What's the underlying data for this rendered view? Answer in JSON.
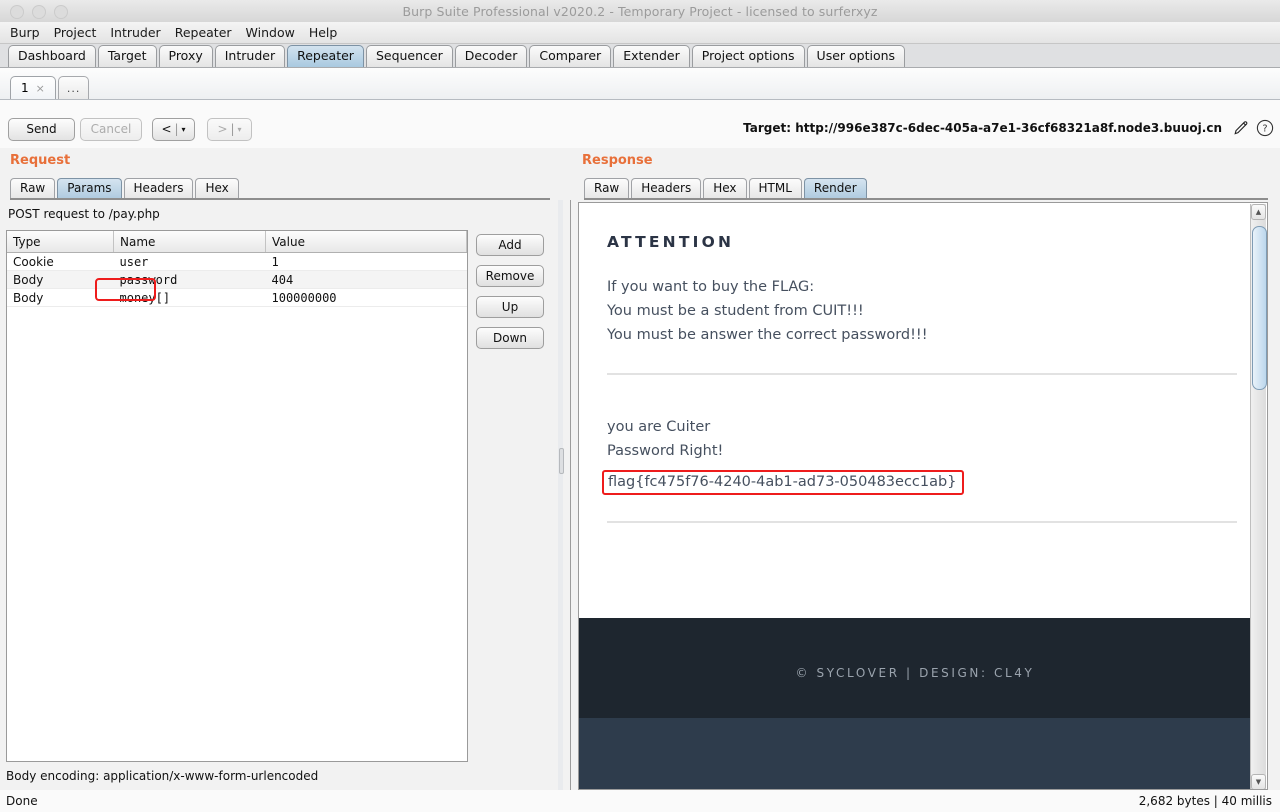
{
  "window": {
    "title": "Burp Suite Professional v2020.2 - Temporary Project - licensed to surferxyz"
  },
  "menubar": {
    "items": [
      "Burp",
      "Project",
      "Intruder",
      "Repeater",
      "Window",
      "Help"
    ]
  },
  "main_tabs": {
    "selected": "Repeater",
    "items": [
      "Dashboard",
      "Target",
      "Proxy",
      "Intruder",
      "Repeater",
      "Sequencer",
      "Decoder",
      "Comparer",
      "Extender",
      "Project options",
      "User options"
    ]
  },
  "repeater_tabs": {
    "items": [
      {
        "label": "1",
        "close": "×",
        "selected": true
      },
      {
        "label": "...",
        "selected": false
      }
    ]
  },
  "actions": {
    "send_label": "Send",
    "cancel_label": "Cancel",
    "back_label": "<",
    "back_caret": "▾",
    "forward_label": ">",
    "forward_caret": "▾",
    "separator": "|"
  },
  "target": {
    "label": "Target:",
    "url": "http://996e387c-6dec-405a-a7e1-36cf68321a8f.node3.buuoj.cn",
    "edit_icon": "pencil-icon",
    "help_icon": "question-mark-icon"
  },
  "request": {
    "title": "Request",
    "tabs": [
      "Raw",
      "Params",
      "Headers",
      "Hex"
    ],
    "selected_tab": "Params",
    "info": "POST request to /pay.php",
    "table": {
      "columns": [
        "Type",
        "Name",
        "Value"
      ],
      "rows": [
        {
          "type": "Cookie",
          "name": "user",
          "value": "1"
        },
        {
          "type": "Body",
          "name": "password",
          "value": "404"
        },
        {
          "type": "Body",
          "name": "money[]",
          "value": "100000000"
        }
      ]
    },
    "buttons": [
      "Add",
      "Remove",
      "Up",
      "Down"
    ],
    "body_encoding": "Body encoding: application/x-www-form-urlencoded"
  },
  "response": {
    "title": "Response",
    "tabs": [
      "Raw",
      "Headers",
      "Hex",
      "HTML",
      "Render"
    ],
    "selected_tab": "Render",
    "render": {
      "heading": "ATTENTION",
      "lines": [
        "If you want to buy the FLAG:",
        "You must be a student from CUIT!!!",
        "You must be answer the correct password!!!"
      ],
      "result_lines": [
        "you are Cuiter",
        "Password Right!"
      ],
      "flag": "flag{fc475f76-4240-4ab1-ad73-050483ecc1ab}",
      "footer": "© SYCLOVER  |  DESIGN: CL4Y"
    }
  },
  "statusbar": {
    "left": "Done",
    "right": "2,682 bytes | 40 millis"
  },
  "colors": {
    "accent": "#e8703a",
    "annotation": "#ee1c1c",
    "tab_selected": "#aecadf",
    "footer_dark": "#1e262f",
    "footer_light": "#2e3c4c"
  }
}
